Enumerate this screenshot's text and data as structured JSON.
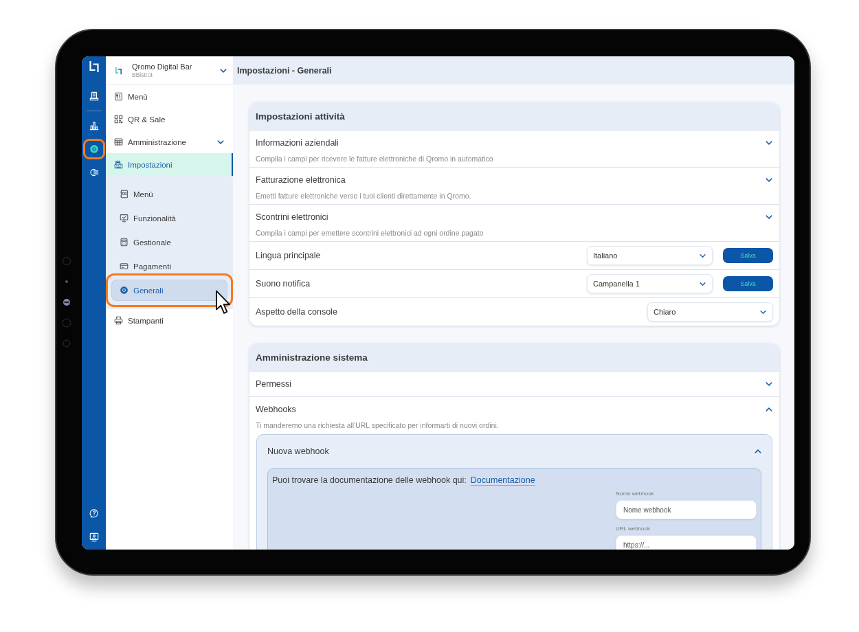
{
  "rail": {
    "top_items": [
      {
        "selected": false,
        "highlighted": false
      },
      {
        "selected": false,
        "highlighted": false
      },
      {
        "selected": true,
        "highlighted": true
      },
      {
        "selected": false,
        "highlighted": false
      }
    ],
    "bottom_items": [
      {
        "selected": false,
        "highlighted": false
      },
      {
        "selected": false,
        "highlighted": false
      }
    ]
  },
  "sidebar": {
    "venue": {
      "name": "Qromo Digital Bar",
      "subtitle": "BBistrot"
    },
    "items": [
      {
        "label": "Menù",
        "selected": false
      },
      {
        "label": "QR & Sale",
        "selected": false
      },
      {
        "label": "Amministrazione",
        "selected": false,
        "expanded": true,
        "children": [
          {
            "label": "Impostazioni",
            "selected": true,
            "children": [
              {
                "label": "Menù",
                "selected": false,
                "highlighted": false
              },
              {
                "label": "Funzionalità",
                "selected": false,
                "highlighted": false
              },
              {
                "label": "Gestionale",
                "selected": false,
                "highlighted": false
              },
              {
                "label": "Pagamenti",
                "selected": false,
                "highlighted": false
              },
              {
                "label": "Generali",
                "selected": true,
                "highlighted": true
              }
            ]
          },
          {
            "label": "Stampanti",
            "selected": false
          }
        ]
      }
    ]
  },
  "header": {
    "title": "Impostazioni - Generali"
  },
  "cards": [
    {
      "title": "Impostazioni attività",
      "rows": [
        {
          "kind": "accordion",
          "title": "Informazioni aziendali",
          "description": "Compila i campi per ricevere le fatture elettroniche di Qromo in automatico",
          "expanded": false
        },
        {
          "kind": "accordion",
          "title": "Fatturazione elettronica",
          "description": "Emetti fatture elettroniche verso i tuoi clienti direttamente in Qromo.",
          "expanded": false
        },
        {
          "kind": "accordion",
          "title": "Scontrini elettronici",
          "description": "Compila i campi per emettere scontrini elettronici ad ogni ordine pagato",
          "expanded": false
        },
        {
          "kind": "select",
          "label": "Lingua principale",
          "value": "Italiano",
          "button": "Salva"
        },
        {
          "kind": "select",
          "label": "Suono notifica",
          "value": "Campanella 1",
          "button": "Salva"
        },
        {
          "kind": "select",
          "label": "Aspetto della console",
          "value": "Chiaro"
        }
      ]
    },
    {
      "title": "Amministrazione sistema",
      "rows": [
        {
          "kind": "accordion",
          "title": "Permessi",
          "expanded": false
        },
        {
          "kind": "accordion",
          "title": "Webhooks",
          "description": "Ti manderemo una richiesta all'URL specificato per informarti di nuovi ordini.",
          "expanded": true,
          "panel": {
            "title": "Nuova webhook",
            "expanded": true,
            "text": "Puoi trovare la documentazione delle webhook qui:",
            "link": "Documentazione",
            "fields": [
              {
                "label": "Nome webhook",
                "placeholder": "Nome webhook"
              },
              {
                "label": "URL webhook",
                "placeholder": "https://..."
              }
            ]
          }
        }
      ]
    }
  ]
}
